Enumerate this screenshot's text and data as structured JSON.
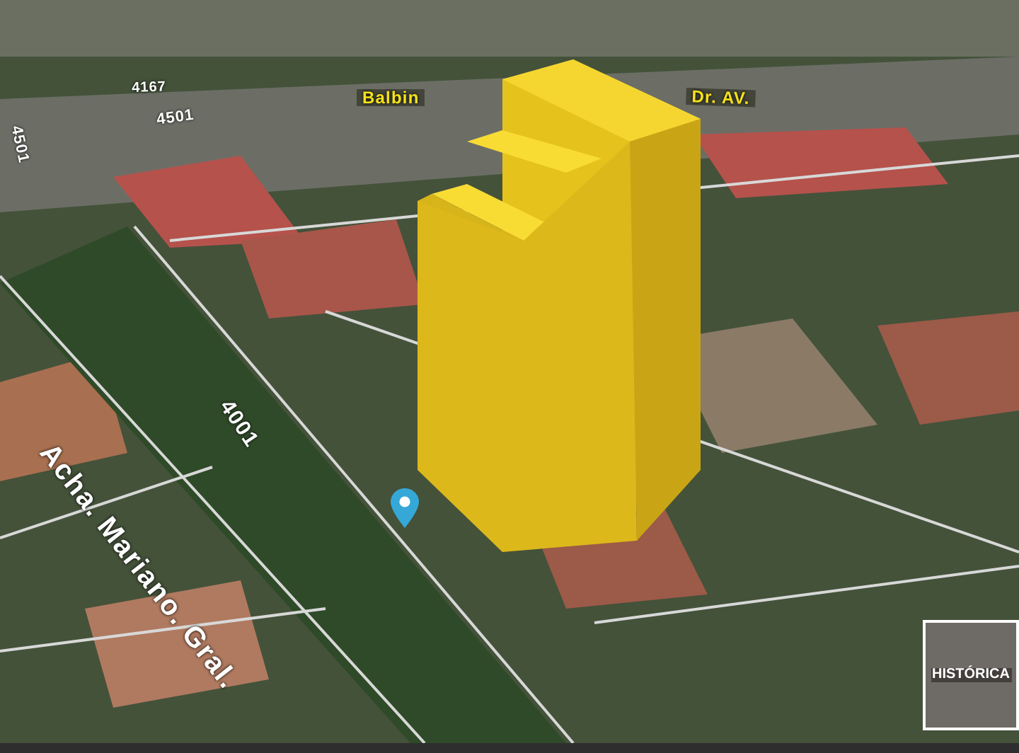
{
  "map": {
    "labels": [
      {
        "text": "4167",
        "kind": "street"
      },
      {
        "text": "4501",
        "kind": "street"
      },
      {
        "text": "4501",
        "kind": "street"
      },
      {
        "text": "Balbin",
        "kind": "avenue"
      },
      {
        "text": "Dr. AV.",
        "kind": "avenue"
      },
      {
        "text": "Acha. Mariano. Gral.",
        "kind": "street"
      },
      {
        "text": "4001",
        "kind": "street"
      }
    ]
  },
  "history_button": {
    "label": "HISTÓRICA"
  }
}
